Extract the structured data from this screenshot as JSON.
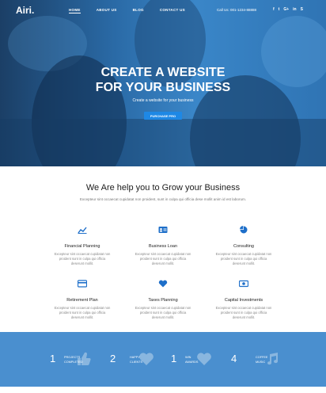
{
  "brand": {
    "logo": "Airi."
  },
  "nav": {
    "items": [
      "HOME",
      "ABOUT US",
      "BLOG",
      "CONTACT US"
    ],
    "call": "Call Us: 001-1234-88888",
    "social": [
      "f",
      "t",
      "G+",
      "in",
      "S"
    ]
  },
  "hero": {
    "title_line1": "CREATE A WEBSITE",
    "title_line2": "FOR YOUR BUSINESS",
    "subtitle": "Create a website for your business",
    "button": "PURCHASE PRO"
  },
  "services": {
    "title": "We Are help you to Grow your Business",
    "subtitle": "Excepteur sint occaecat cupidatat non proident, sunt in culpa qui officia dese mollit anim id est laborum.",
    "items": [
      {
        "icon": "chart-line-icon",
        "title": "Financial Planning",
        "desc_line1": "Excepteur sint occaecat cupidatat non",
        "desc_line2": "proident sunt in culpa qui officia",
        "desc_line3": "deserunt mollit."
      },
      {
        "icon": "id-card-icon",
        "title": "Business Loan",
        "desc_line1": "Excepteur sint occaecat cupidatat non",
        "desc_line2": "proident sunt in culpa qui officia",
        "desc_line3": "deserunt mollit."
      },
      {
        "icon": "pie-chart-icon",
        "title": "Consulting",
        "desc_line1": "Excepteur sint occaecat cupidatat non",
        "desc_line2": "proident sunt in culpa qui officia",
        "desc_line3": "deserunt mollit."
      },
      {
        "icon": "credit-card-icon",
        "title": "Retirement Plan",
        "desc_line1": "Excepteur sint occaecat cupidatat non",
        "desc_line2": "proident sunt in culpa qui officia",
        "desc_line3": "deserunt mollit."
      },
      {
        "icon": "heart-icon",
        "title": "Taxes Planning",
        "desc_line1": "Excepteur sint occaecat cupidatat non",
        "desc_line2": "proident sunt in culpa qui officia",
        "desc_line3": "deserunt mollit."
      },
      {
        "icon": "money-bill-icon",
        "title": "Capital Investments",
        "desc_line1": "Excepteur sint occaecat cupidatat non",
        "desc_line2": "proident sunt in culpa qui officia",
        "desc_line3": "deserunt mollit."
      }
    ]
  },
  "stats": {
    "items": [
      {
        "num": "1",
        "line1": "PROJECTS",
        "line2": "COMPLETED",
        "icon": "thumbs-up-icon"
      },
      {
        "num": "2",
        "line1": "HAPPY",
        "line2": "CLIENTS",
        "icon": "heart-icon"
      },
      {
        "num": "1",
        "line1": "WIN",
        "line2": "AWARDS",
        "icon": "heart-icon"
      },
      {
        "num": "4",
        "line1": "COFFEE",
        "line2": "MUSIC",
        "icon": "music-icon"
      }
    ]
  },
  "colors": {
    "accent": "#1e88e5",
    "stats_bg": "#4a8fcf",
    "icon": "#1e6fc9"
  }
}
